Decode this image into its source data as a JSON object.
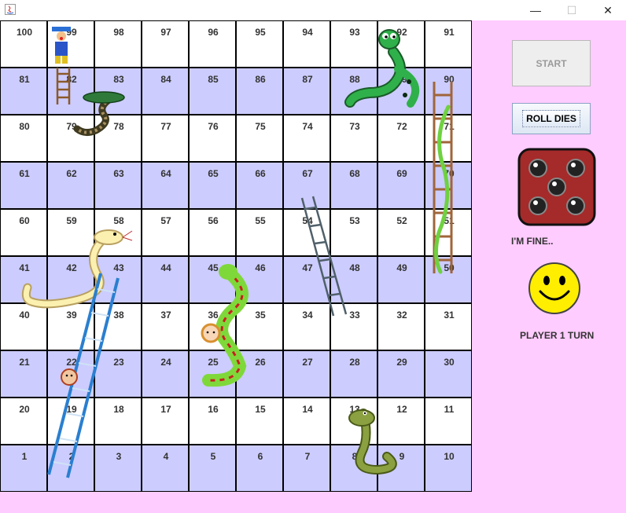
{
  "window": {
    "minimize_glyph": "—",
    "maximize_glyph": "☐",
    "close_glyph": "✕"
  },
  "board": {
    "rows": [
      [
        100,
        99,
        98,
        97,
        96,
        95,
        94,
        93,
        92,
        91
      ],
      [
        81,
        82,
        83,
        84,
        85,
        86,
        87,
        88,
        89,
        90
      ],
      [
        80,
        79,
        78,
        77,
        76,
        75,
        74,
        73,
        72,
        71
      ],
      [
        61,
        62,
        63,
        64,
        65,
        66,
        67,
        68,
        69,
        70
      ],
      [
        60,
        59,
        58,
        57,
        56,
        55,
        54,
        53,
        52,
        51
      ],
      [
        41,
        42,
        43,
        44,
        45,
        46,
        47,
        48,
        49,
        50
      ],
      [
        40,
        39,
        38,
        37,
        36,
        35,
        34,
        33,
        32,
        31
      ],
      [
        21,
        22,
        23,
        24,
        25,
        26,
        27,
        28,
        29,
        30
      ],
      [
        20,
        19,
        18,
        17,
        16,
        15,
        14,
        13,
        12,
        11
      ],
      [
        1,
        2,
        3,
        4,
        5,
        6,
        7,
        8,
        9,
        10
      ]
    ],
    "colors": {
      "light_row": "#ffffff",
      "dark_row": "#ccccff",
      "grid": "#000000"
    }
  },
  "controls": {
    "start_label": "START",
    "roll_label": "ROLL DIES"
  },
  "dice": {
    "value": 5,
    "color": "#a52a2a"
  },
  "status": {
    "message": "I'M FINE..",
    "turn": "PLAYER 1 TURN"
  },
  "background": "#ffccff"
}
